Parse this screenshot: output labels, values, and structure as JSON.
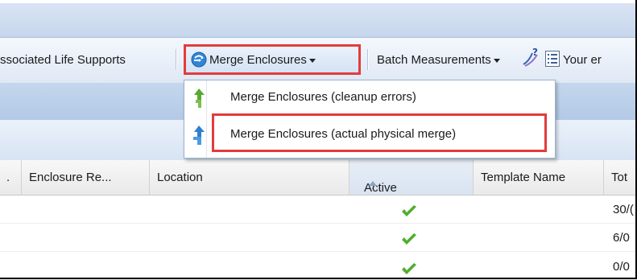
{
  "toolbar": {
    "associated_label": "ssociated Life Supports",
    "merge_label": "Merge Enclosures",
    "batch_label": "Batch Measurements",
    "your_label": "Your er"
  },
  "merge_menu": {
    "items": [
      {
        "label": "Merge Enclosures (cleanup errors)"
      },
      {
        "label": "Merge Enclosures (actual physical merge)"
      }
    ]
  },
  "grid": {
    "columns": [
      {
        "label": "."
      },
      {
        "label": "Enclosure Re..."
      },
      {
        "label": "Location"
      },
      {
        "label": "Active"
      },
      {
        "label": "Template Name"
      },
      {
        "label": "Tot"
      }
    ],
    "rows": [
      {
        "active": true,
        "total": "30/("
      },
      {
        "active": true,
        "total": "6/0"
      },
      {
        "active": true,
        "total": "0/0"
      }
    ]
  },
  "colors": {
    "highlight": "#e23c3c",
    "check": "#4fae2e",
    "header_band": "#c6d6ec"
  }
}
